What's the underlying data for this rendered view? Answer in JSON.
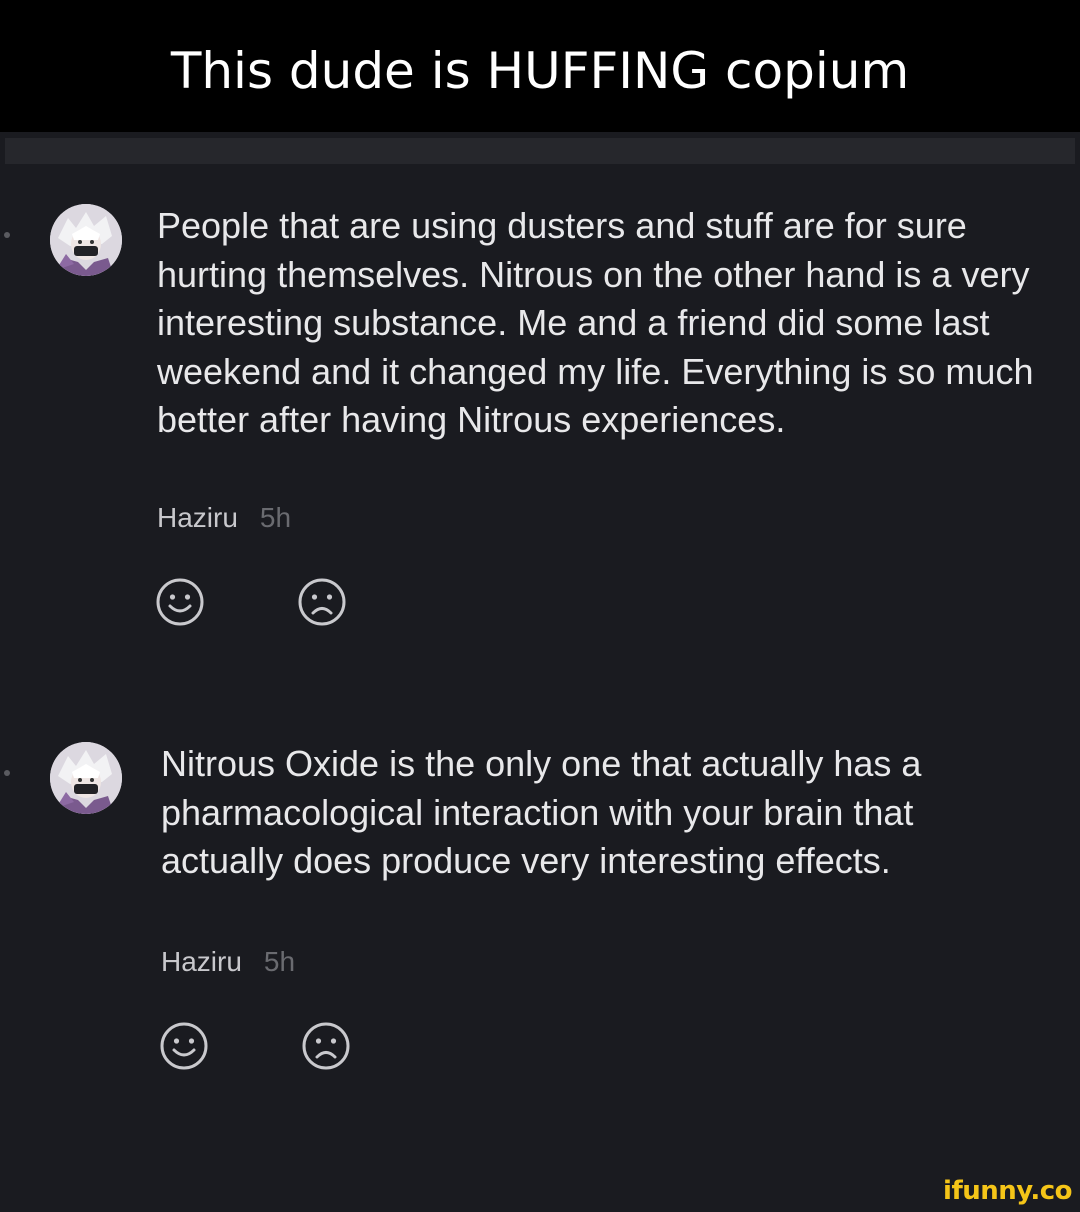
{
  "caption": "This dude is HUFFING copium",
  "comments": [
    {
      "avatar_icon": "anime-avatar-icon",
      "text": "People that are using dusters and stuff are for sure hurting themselves. Nitrous on the other hand is a very interesting substance. Me and a friend did some last weekend and it changed my life. Everything is so much better after having Nitrous experiences.",
      "author": "Haziru",
      "time": "5h",
      "reactions": [
        "smile-icon",
        "frown-icon"
      ]
    },
    {
      "avatar_icon": "anime-avatar-icon",
      "text": "Nitrous Oxide is the only one that actually has a pharmacological interaction with your brain that actually does produce very interesting effects.",
      "author": "Haziru",
      "time": "5h",
      "reactions": [
        "smile-icon",
        "frown-icon"
      ]
    }
  ],
  "watermark": "ifunny.co",
  "colors": {
    "caption_bg": "#000000",
    "background": "#1a1b20",
    "text": "#e8e8ea",
    "muted": "#6a6b70",
    "watermark": "#f5c518"
  }
}
